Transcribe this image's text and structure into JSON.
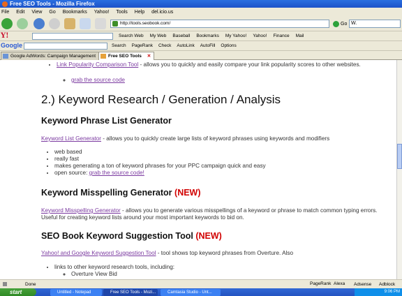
{
  "window": {
    "title": "Free SEO Tools - Mozilla Firefox"
  },
  "menu": [
    "File",
    "Edit",
    "View",
    "Go",
    "Bookmarks",
    "Yahoo!",
    "Tools",
    "Help",
    "del.icio.us"
  ],
  "nav": {
    "url": "http://tools.seobook.com/",
    "go_label": "Go",
    "search_value": "W."
  },
  "yahoo_toolbar": {
    "logo": "Y!",
    "links": [
      "Search Web",
      "My Web",
      "Baseball",
      "Bookmarks",
      "My Yahoo!",
      "Yahoo!",
      "Finance",
      "Mail"
    ]
  },
  "google_toolbar": {
    "logo": "Google",
    "links": [
      "Search",
      "PageRank",
      "Check",
      "AutoLink",
      "AutoFill",
      "Options"
    ]
  },
  "tabs": [
    {
      "label": "Google AdWords: Campaign Management"
    },
    {
      "label": "Free SEO Tools"
    }
  ],
  "page": {
    "top_link": "Link Popularity Comparison Tool",
    "top_text": " - allows you to quickly and easily compare your link popularity scores to other websites.",
    "top_source": "grab the source code",
    "section_title": "2.) Keyword Research / Generation / Analysis",
    "h_phrase": "Keyword Phrase List Generator",
    "phrase_link": "Keyword List Generator",
    "phrase_text": " - allows you to quickly create large lists of keyword phrases using keywords and modifiers",
    "phrase_items": [
      "web based",
      "really fast",
      "makes generating a ton of keyword phrases for your PPC campaign quick and easy",
      "open source: "
    ],
    "phrase_source": "grab the source code!",
    "h_misspell": "Keyword Misspelling Generator",
    "new_label": "(NEW)",
    "misspell_link": "Keyword Misspelling Generator",
    "misspell_text": " - allows you to generate various misspellings of a keyword or phrase to match common typing errors. Useful for creating keyword lists around your most important keywords to bid on.",
    "h_suggest": "SEO Book Keyword Suggestion Tool",
    "suggest_link": "Yahoo! and Google Keyword Suggestion Tool",
    "suggest_text": " - tool shows top keyword phrases from Overture. Also",
    "suggest_items": [
      "links to other keyword research tools, including:"
    ],
    "suggest_sub": [
      "Overture View Bid"
    ]
  },
  "status": {
    "text": "Done",
    "right": [
      "PageRank",
      "Alexa",
      "Adsense",
      "Adblock"
    ]
  },
  "taskbar": {
    "start": "start",
    "tasks": [
      "Untitled - Notepad",
      "Free SEO Tools - Mozi...",
      "Camtasia Studio - Unt..."
    ],
    "clock": "9:06 PM"
  },
  "colors": {
    "link": "#7b3aa0",
    "new": "#d10000",
    "titlebar": "#1c52c9"
  }
}
